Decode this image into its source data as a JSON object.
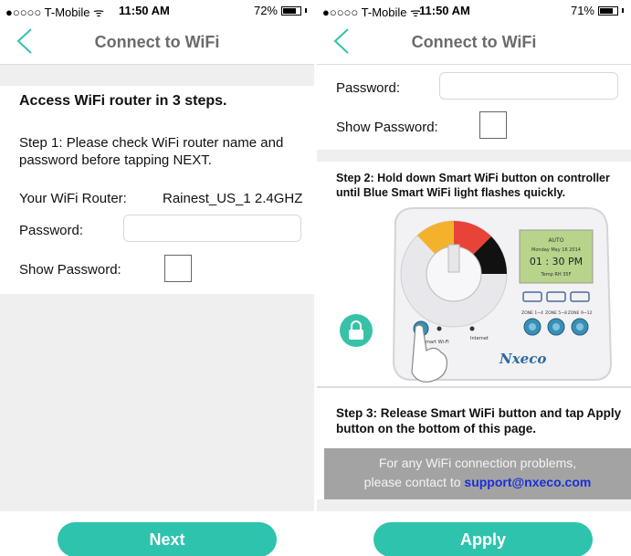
{
  "left": {
    "status": {
      "carrier": "●○○○○ T-Mobile ᯤ",
      "time": "11:50 AM",
      "battery": "72%",
      "battery_level": 0.72
    },
    "nav": {
      "title": "Connect to WiFi"
    },
    "heading": "Access WiFi router in 3 steps.",
    "step1": "Step 1: Please check WiFi router name and password before tapping NEXT.",
    "router_label": "Your WiFi Router:",
    "router_value": "Rainest_US_1 2.4GHZ",
    "password_label": "Password:",
    "password_value": "",
    "show_password_label": "Show Password:",
    "next_label": "Next"
  },
  "right": {
    "status": {
      "carrier": "●○○○○ T-Mobile ᯤ",
      "time": "11:50 AM",
      "battery": "71%",
      "battery_level": 0.71
    },
    "nav": {
      "title": "Connect to WiFi"
    },
    "password_label": "Password:",
    "password_value": "",
    "show_password_label": "Show Password:",
    "step2": "Step 2: Hold down Smart WiFi button on controller until Blue Smart WiFi light flashes quickly.",
    "controller": {
      "lcd_line1": "AUTO",
      "lcd_line2": "Monday May 16 2014",
      "lcd_time": "01 : 30  PM",
      "lcd_line4": "Temp      RH 35F",
      "zone1": "ZONE 1~4",
      "zone2": "ZONE 5~8",
      "zone3": "ZONE 9~12",
      "smart_label": "Smart Wi-Fi",
      "internet_label": "Internet",
      "brand": "Nxeco"
    },
    "step3": "Step 3: Release Smart WiFi button and tap Apply button on the bottom of this page.",
    "help_line1": "For any WiFi connection problems,",
    "help_line2": "please contact to",
    "help_email": "support@nxeco.com",
    "apply_label": "Apply"
  },
  "colors": {
    "accent": "#2ec3ad",
    "link": "#1a2fd6",
    "help_bg": "#a3a3a3"
  },
  "icons": {
    "back": "chevron-left-icon",
    "lock": "lock-icon",
    "wifi": "wifi-icon"
  }
}
